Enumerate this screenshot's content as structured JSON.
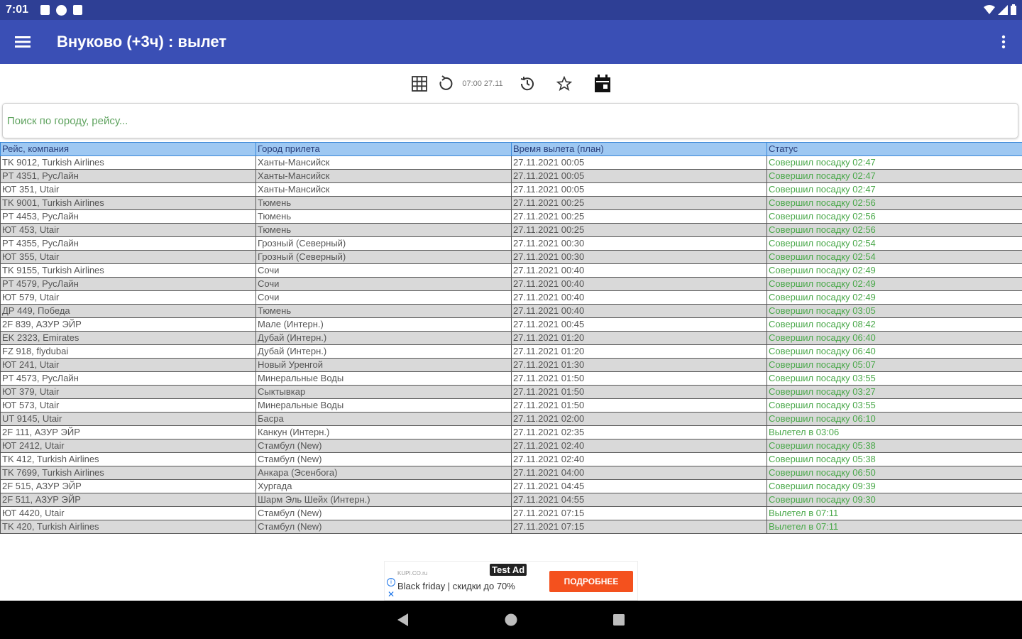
{
  "status_bar": {
    "time": "7:01"
  },
  "app_bar": {
    "title": "Внуково (+3ч) : вылет"
  },
  "toolbar": {
    "updated_time": "07:00 27.11"
  },
  "search": {
    "placeholder": "Поиск по городу, рейсу..."
  },
  "table": {
    "headers": [
      "Рейс, компания",
      "Город прилета",
      "Время вылета (план)",
      "Статус"
    ],
    "rows": [
      [
        "TK 9012, Turkish Airlines",
        "Ханты-Мансийск",
        "27.11.2021 00:05",
        "Совершил посадку 02:47"
      ],
      [
        "PT 4351, РусЛайн",
        "Ханты-Мансийск",
        "27.11.2021 00:05",
        "Совершил посадку 02:47"
      ],
      [
        "ЮТ 351, Utair",
        "Ханты-Мансийск",
        "27.11.2021 00:05",
        "Совершил посадку 02:47"
      ],
      [
        "TK 9001, Turkish Airlines",
        "Тюмень",
        "27.11.2021 00:25",
        "Совершил посадку 02:56"
      ],
      [
        "PT 4453, РусЛайн",
        "Тюмень",
        "27.11.2021 00:25",
        "Совершил посадку 02:56"
      ],
      [
        "ЮТ 453, Utair",
        "Тюмень",
        "27.11.2021 00:25",
        "Совершил посадку 02:56"
      ],
      [
        "PT 4355, РусЛайн",
        "Грозный (Северный)",
        "27.11.2021 00:30",
        "Совершил посадку 02:54"
      ],
      [
        "ЮТ 355, Utair",
        "Грозный (Северный)",
        "27.11.2021 00:30",
        "Совершил посадку 02:54"
      ],
      [
        "TK 9155, Turkish Airlines",
        "Сочи",
        "27.11.2021 00:40",
        "Совершил посадку 02:49"
      ],
      [
        "PT 4579, РусЛайн",
        "Сочи",
        "27.11.2021 00:40",
        "Совершил посадку 02:49"
      ],
      [
        "ЮТ 579, Utair",
        "Сочи",
        "27.11.2021 00:40",
        "Совершил посадку 02:49"
      ],
      [
        "ДР 449, Победа",
        "Тюмень",
        "27.11.2021 00:40",
        "Совершил посадку 03:05"
      ],
      [
        "2F 839, АЗУР ЭЙР",
        "Мале (Интерн.)",
        "27.11.2021 00:45",
        "Совершил посадку 08:42"
      ],
      [
        "EK 2323, Emirates",
        "Дубай (Интерн.)",
        "27.11.2021 01:20",
        "Совершил посадку 06:40"
      ],
      [
        "FZ 918, flydubai",
        "Дубай (Интерн.)",
        "27.11.2021 01:20",
        "Совершил посадку 06:40"
      ],
      [
        "ЮТ 241, Utair",
        "Новый Уренгой",
        "27.11.2021 01:30",
        "Совершил посадку 05:07"
      ],
      [
        "PT 4573, РусЛайн",
        "Минеральные Воды",
        "27.11.2021 01:50",
        "Совершил посадку 03:55"
      ],
      [
        "ЮТ 379, Utair",
        "Сыктывкар",
        "27.11.2021 01:50",
        "Совершил посадку 03:27"
      ],
      [
        "ЮТ 573, Utair",
        "Минеральные Воды",
        "27.11.2021 01:50",
        "Совершил посадку 03:55"
      ],
      [
        "UT 9145, Utair",
        "Басра",
        "27.11.2021 02:00",
        "Совершил посадку 06:10"
      ],
      [
        "2F 111, АЗУР ЭЙР",
        "Канкун (Интерн.)",
        "27.11.2021 02:35",
        "Вылетел в 03:06"
      ],
      [
        "ЮТ 2412, Utair",
        "Стамбул (New)",
        "27.11.2021 02:40",
        "Совершил посадку 05:38"
      ],
      [
        "TK 412, Turkish Airlines",
        "Стамбул (New)",
        "27.11.2021 02:40",
        "Совершил посадку 05:38"
      ],
      [
        "TK 7699, Turkish Airlines",
        "Анкара (Эсенбога)",
        "27.11.2021 04:00",
        "Совершил посадку 06:50"
      ],
      [
        "2F 515, АЗУР ЭЙР",
        "Хургада",
        "27.11.2021 04:45",
        "Совершил посадку 09:39"
      ],
      [
        "2F 511, АЗУР ЭЙР",
        "Шарм Эль Шейх (Интерн.)",
        "27.11.2021 04:55",
        "Совершил посадку 09:30"
      ],
      [
        "ЮТ 4420, Utair",
        "Стамбул (New)",
        "27.11.2021 07:15",
        "Вылетел в 07:11"
      ],
      [
        "TK 420, Turkish Airlines",
        "Стамбул (New)",
        "27.11.2021 07:15",
        "Вылетел в 07:11"
      ]
    ]
  },
  "ad": {
    "source": "KUPI.CO.ru",
    "badge": "Test Ad",
    "text": "Black friday | скидки до 70%",
    "cta": "ПОДРОБНЕЕ"
  },
  "colors": {
    "status_bar": "#2e3f95",
    "app_bar": "#3a4fb5",
    "header_row": "#9ec8f2",
    "alt_row": "#d9d9d9",
    "status_text": "#4aa84a",
    "ad_cta": "#f4511e"
  }
}
